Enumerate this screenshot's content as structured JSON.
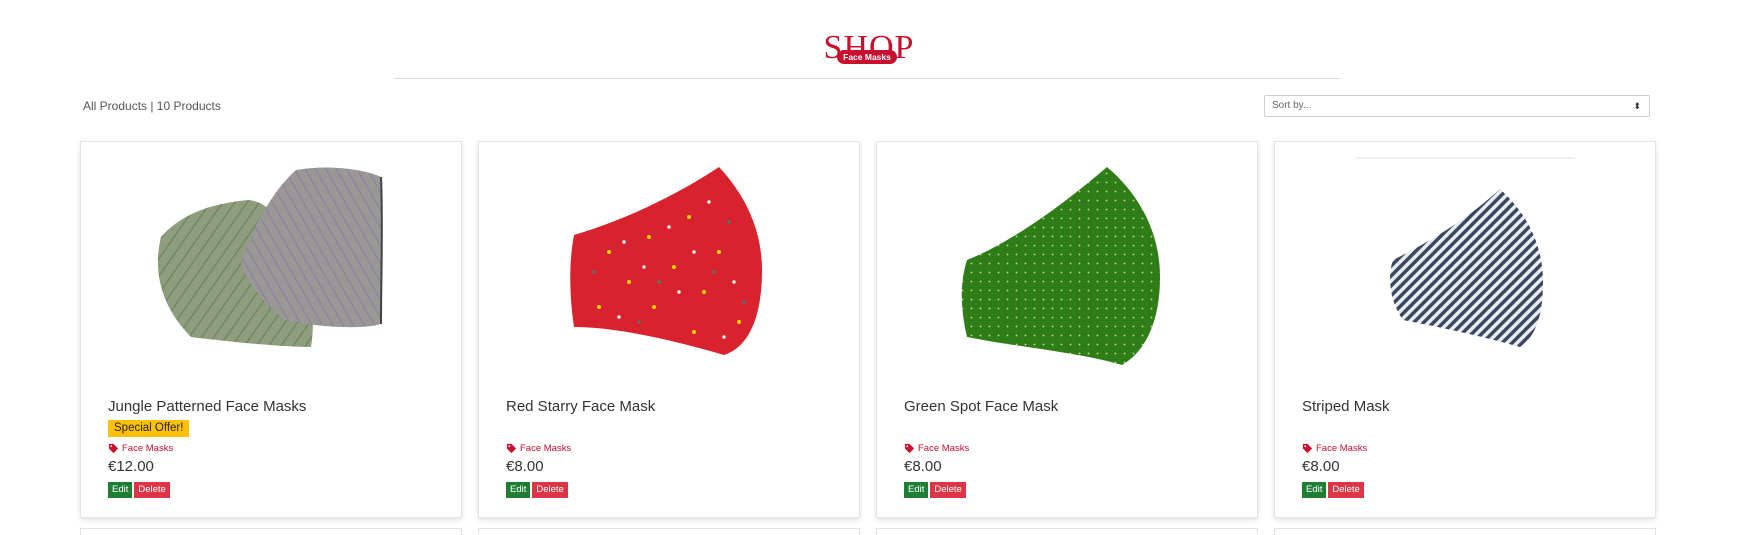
{
  "header": {
    "title": "SHOP",
    "category_badge": "Face Masks"
  },
  "toolbar": {
    "product_count": "All Products | 10 Products",
    "sort_placeholder": "Sort by...",
    "sort_arrows": "⬍"
  },
  "products": [
    {
      "name": "Jungle Patterned Face Masks",
      "badge": "Special Offer!",
      "category": "Face Masks",
      "price": "€12.00",
      "edit_label": "Edit",
      "delete_label": "Delete"
    },
    {
      "name": "Red Starry Face Mask",
      "badge": "",
      "category": "Face Masks",
      "price": "€8.00",
      "edit_label": "Edit",
      "delete_label": "Delete"
    },
    {
      "name": "Green Spot Face Mask",
      "badge": "",
      "category": "Face Masks",
      "price": "€8.00",
      "edit_label": "Edit",
      "delete_label": "Delete"
    },
    {
      "name": "Striped Mask",
      "badge": "",
      "category": "Face Masks",
      "price": "€8.00",
      "edit_label": "Edit",
      "delete_label": "Delete"
    }
  ],
  "colors": {
    "brand_red": "#c8102e",
    "edit_green": "#1e7e34",
    "delete_red": "#dc3545",
    "offer_yellow": "#ffc107"
  },
  "icons": {
    "category": "tag-icon",
    "sort": "sort-arrows-icon"
  }
}
